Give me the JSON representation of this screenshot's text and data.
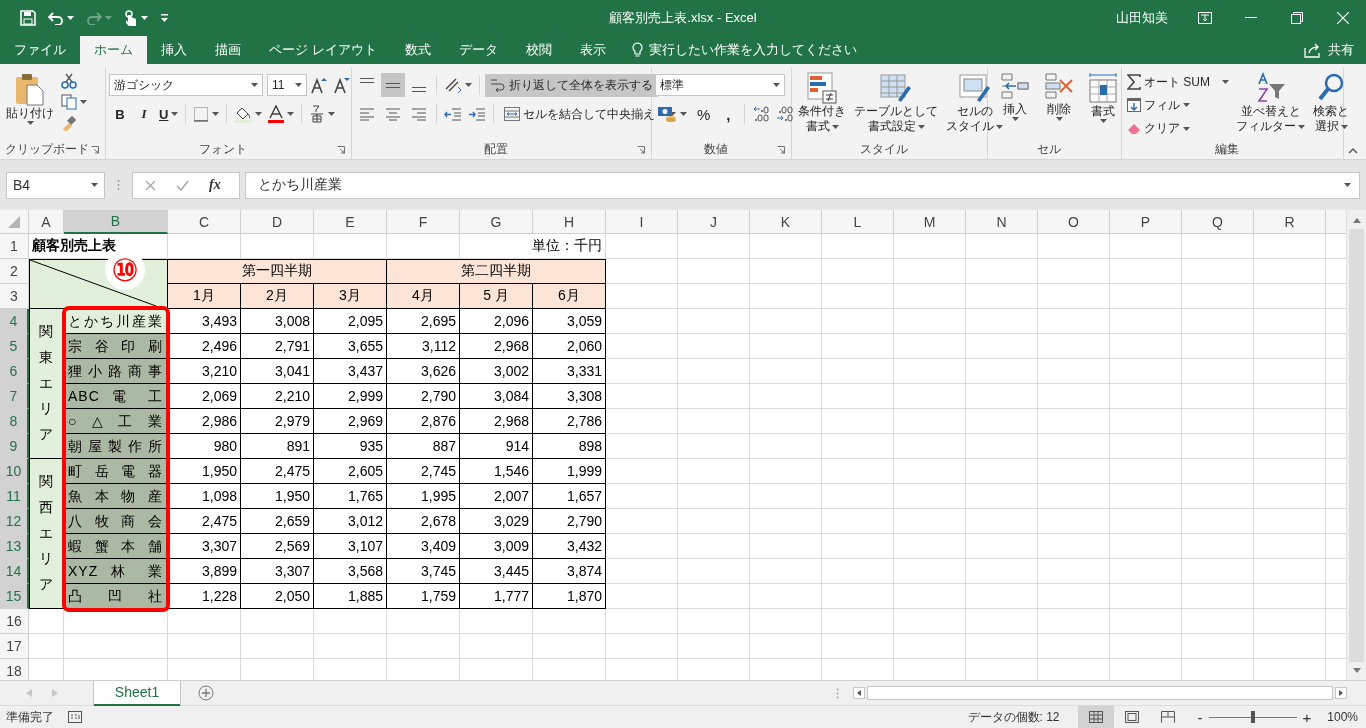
{
  "title_bar": {
    "title": "顧客別売上表.xlsx  -  Excel",
    "user": "山田知美"
  },
  "tabs": [
    {
      "label": "ファイル",
      "selected": false
    },
    {
      "label": "ホーム",
      "selected": true
    },
    {
      "label": "挿入",
      "selected": false
    },
    {
      "label": "描画",
      "selected": false
    },
    {
      "label": "ページ レイアウト",
      "selected": false
    },
    {
      "label": "数式",
      "selected": false
    },
    {
      "label": "データ",
      "selected": false
    },
    {
      "label": "校閲",
      "selected": false
    },
    {
      "label": "表示",
      "selected": false
    }
  ],
  "tell_me": {
    "placeholder": "実行したい作業を入力してください"
  },
  "share": "共有",
  "ribbon": {
    "clipboard": {
      "label": "クリップボード",
      "paste": "貼り付け"
    },
    "font": {
      "label": "フォント",
      "name": "游ゴシック",
      "size": "11",
      "bold": "B",
      "italic": "I",
      "underline": "U"
    },
    "alignment": {
      "label": "配置",
      "vertical_align": [
        {
          "kind": "top",
          "selected": false
        },
        {
          "kind": "middle",
          "selected": true
        },
        {
          "kind": "bottom",
          "selected": false
        }
      ],
      "wrap_text": {
        "label": "折り返して全体を表示する",
        "on": true
      },
      "merge": "セルを結合して中央揃え"
    },
    "number": {
      "label": "数値",
      "format": "標準",
      "percent": "%",
      "comma": ","
    },
    "styles": {
      "label": "スタイル",
      "buttons": [
        {
          "kind": "conditional",
          "lines": [
            "条件付き",
            "書式"
          ]
        },
        {
          "kind": "table",
          "lines": [
            "テーブルとして",
            "書式設定"
          ]
        },
        {
          "kind": "cell",
          "lines": [
            "セルの",
            "スタイル"
          ]
        }
      ]
    },
    "cells": {
      "label": "セル",
      "buttons": [
        {
          "kind": "insert",
          "label": "挿入"
        },
        {
          "kind": "delete",
          "label": "削除"
        },
        {
          "kind": "format",
          "label": "書式"
        }
      ]
    },
    "editing": {
      "label": "編集",
      "autosum": "オート SUM",
      "fill": "フィル",
      "clear": "クリア",
      "sort": [
        "並べ替えと",
        "フィルター"
      ],
      "find": [
        "検索と",
        "選択"
      ]
    }
  },
  "formula_bar": {
    "name_box": "B4",
    "fx": "fx",
    "formula": "とかち川産業"
  },
  "sheet": {
    "columns": [
      {
        "label": "A",
        "selected": false
      },
      {
        "label": "B",
        "selected": true
      },
      {
        "label": "C",
        "selected": false
      },
      {
        "label": "D",
        "selected": false
      },
      {
        "label": "E",
        "selected": false
      },
      {
        "label": "F",
        "selected": false
      },
      {
        "label": "G",
        "selected": false
      },
      {
        "label": "H",
        "selected": false
      },
      {
        "label": "I",
        "selected": false
      },
      {
        "label": "J",
        "selected": false
      },
      {
        "label": "K",
        "selected": false
      },
      {
        "label": "L",
        "selected": false
      },
      {
        "label": "M",
        "selected": false
      },
      {
        "label": "N",
        "selected": false
      },
      {
        "label": "O",
        "selected": false
      },
      {
        "label": "P",
        "selected": false
      },
      {
        "label": "Q",
        "selected": false
      },
      {
        "label": "R",
        "selected": false
      }
    ],
    "rows": [
      {
        "label": "1",
        "selected": false
      },
      {
        "label": "2",
        "selected": false
      },
      {
        "label": "3",
        "selected": false
      },
      {
        "label": "4",
        "selected": true
      },
      {
        "label": "5",
        "selected": true
      },
      {
        "label": "6",
        "selected": true
      },
      {
        "label": "7",
        "selected": true
      },
      {
        "label": "8",
        "selected": true
      },
      {
        "label": "9",
        "selected": true
      },
      {
        "label": "10",
        "selected": true
      },
      {
        "label": "11",
        "selected": true
      },
      {
        "label": "12",
        "selected": true
      },
      {
        "label": "13",
        "selected": true
      },
      {
        "label": "14",
        "selected": true
      },
      {
        "label": "15",
        "selected": true
      },
      {
        "label": "16",
        "selected": false
      },
      {
        "label": "17",
        "selected": false
      },
      {
        "label": "18",
        "selected": false
      }
    ],
    "title": "顧客別売上表",
    "unit": "単位：千円",
    "quarters": [
      "第一四半期",
      "第二四半期"
    ],
    "months": [
      "1月",
      "2月",
      "3月",
      "4月",
      "5 月",
      "6月"
    ],
    "regions": [
      {
        "name": "関東エリア",
        "customers": [
          {
            "name": "とかち川産業",
            "selected": false,
            "values": [
              "3,493",
              "3,008",
              "2,095",
              "2,695",
              "2,096",
              "3,059"
            ]
          },
          {
            "name": "宗 谷 印 刷",
            "selected": true,
            "values": [
              "2,496",
              "2,791",
              "3,655",
              "3,112",
              "2,968",
              "2,060"
            ]
          },
          {
            "name": "狸小路商事",
            "selected": true,
            "values": [
              "3,210",
              "3,041",
              "3,437",
              "3,626",
              "3,002",
              "3,331"
            ]
          },
          {
            "name": "ABC 電 工",
            "selected": true,
            "values": [
              "2,069",
              "2,210",
              "2,999",
              "2,790",
              "3,084",
              "3,308"
            ]
          },
          {
            "name": "○ △ 工 業",
            "selected": true,
            "values": [
              "2,986",
              "2,979",
              "2,969",
              "2,876",
              "2,968",
              "2,786"
            ]
          },
          {
            "name": "朝屋製作所",
            "selected": true,
            "values": [
              "980",
              "891",
              "935",
              "887",
              "914",
              "898"
            ]
          }
        ]
      },
      {
        "name": "関西エリア",
        "customers": [
          {
            "name": "町 岳 電 器",
            "selected": true,
            "values": [
              "1,950",
              "2,475",
              "2,605",
              "2,745",
              "1,546",
              "1,999"
            ]
          },
          {
            "name": "魚 本 物 産",
            "selected": true,
            "values": [
              "1,098",
              "1,950",
              "1,765",
              "1,995",
              "2,007",
              "1,657"
            ]
          },
          {
            "name": "八 牧 商 会",
            "selected": true,
            "values": [
              "2,475",
              "2,659",
              "3,012",
              "2,678",
              "3,029",
              "2,790"
            ]
          },
          {
            "name": "蝦 蟹 本 舗",
            "selected": true,
            "values": [
              "3,307",
              "2,569",
              "3,107",
              "3,409",
              "3,009",
              "3,432"
            ]
          },
          {
            "name": "XYZ 林 業",
            "selected": true,
            "values": [
              "3,899",
              "3,307",
              "3,568",
              "3,745",
              "3,445",
              "3,874"
            ]
          },
          {
            "name": "凸 凹 社",
            "selected": true,
            "values": [
              "1,228",
              "2,050",
              "1,885",
              "1,759",
              "1,777",
              "1,870"
            ]
          }
        ]
      }
    ]
  },
  "annotation": {
    "step": "⑩"
  },
  "sheet_tabs": [
    {
      "label": "Sheet1",
      "selected": true
    }
  ],
  "status_bar": {
    "status": "準備完了",
    "count": "データの個数: 12",
    "views": [
      {
        "kind": "normal",
        "selected": true
      },
      {
        "kind": "page_layout",
        "selected": false
      },
      {
        "kind": "page_break",
        "selected": false
      }
    ],
    "zoom_out": "-",
    "zoom_in": "+",
    "zoom": {
      "level": 0.5,
      "reading": "100%"
    }
  }
}
